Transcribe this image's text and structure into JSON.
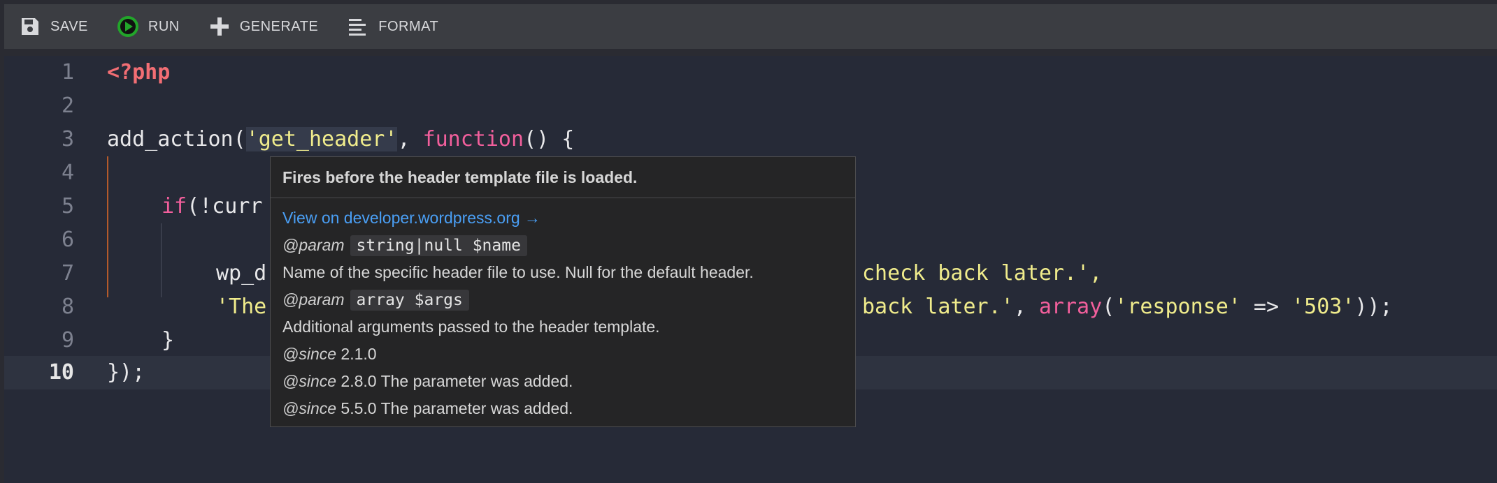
{
  "toolbar": {
    "items": [
      {
        "label": "SAVE",
        "icon": "floppy-disk-icon"
      },
      {
        "label": "RUN",
        "icon": "play-circle-icon"
      },
      {
        "label": "GENERATE",
        "icon": "plus-icon"
      },
      {
        "label": "FORMAT",
        "icon": "align-left-icon"
      }
    ]
  },
  "editor": {
    "active_line": 10,
    "line_numbers": [
      "1",
      "2",
      "3",
      "4",
      "5",
      "6",
      "7",
      "8",
      "9",
      "10"
    ],
    "lines": {
      "l1_tag": "<?php",
      "l3_fn": "add_action(",
      "l3_str": "'get_header'",
      "l3_sep": ", ",
      "l3_kw": "function",
      "l3_end": "() {",
      "l5_kw": "if",
      "l5_rest": "(!curr",
      "l7_fn": "wp_d",
      "l7_str_tail": "check back later.',",
      "l8_str_head": "'The",
      "l8_str_mid": "back later.'",
      "l8_sep": ", ",
      "l8_kw": "array",
      "l8_paren": "(",
      "l8_str1": "'response'",
      "l8_arrow": " => ",
      "l8_str2": "'503'",
      "l8_end": "));",
      "l9": "}",
      "l10": "});"
    }
  },
  "tooltip": {
    "title": "Fires before the header template file is loaded.",
    "link": "View on developer.wordpress.org →",
    "param1_tag": "@param",
    "param1_code": "string|null $name",
    "param1_desc": "Name of the specific header file to use. Null for the default header.",
    "param2_tag": "@param",
    "param2_code": "array $args",
    "param2_desc": "Additional arguments passed to the header template.",
    "since1_tag": "@since",
    "since1_text": " 2.1.0",
    "since2_tag": "@since",
    "since2_text": " 2.8.0 The parameter was added.",
    "since3_tag": "@since",
    "since3_text": " 5.5.0 The parameter was added."
  },
  "colors": {
    "keyword": "#f25f9c",
    "string": "#f0ec8c",
    "php_tag": "#f26e74",
    "link": "#4a9ff5",
    "run_icon": "#22a52a"
  }
}
